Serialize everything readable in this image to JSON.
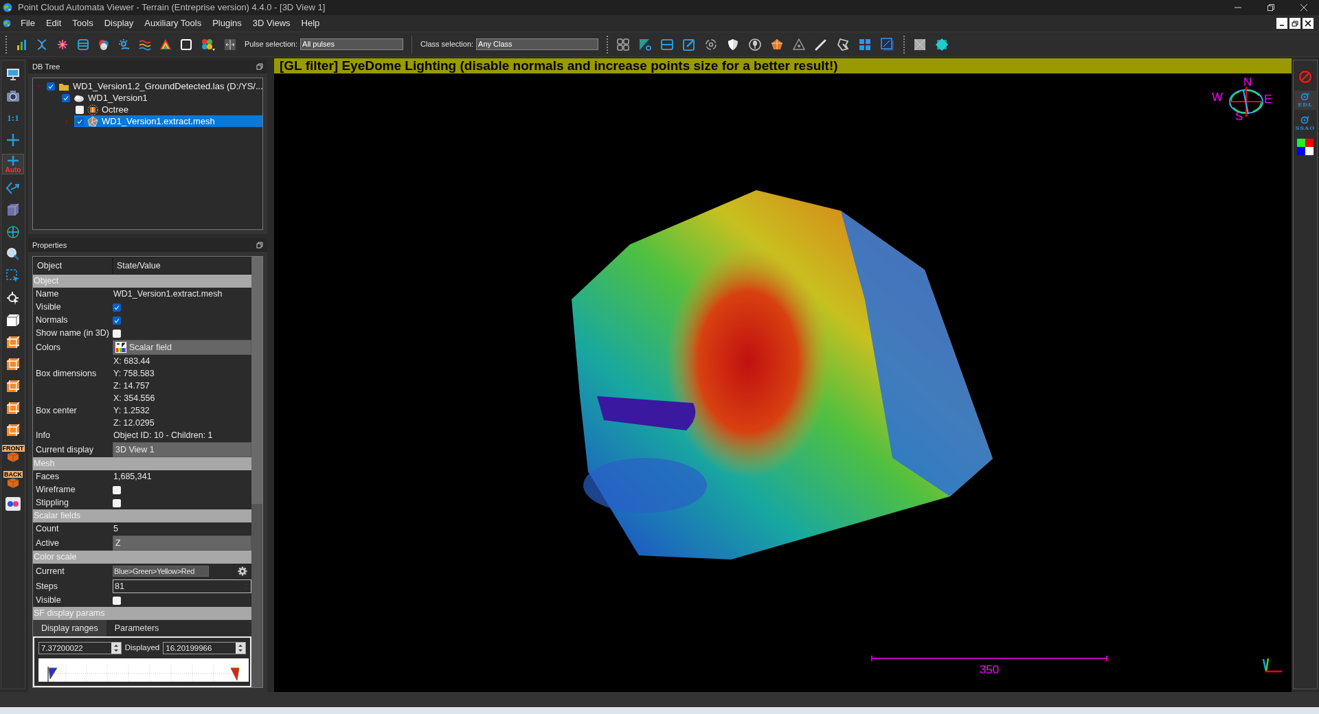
{
  "window": {
    "title": "Point Cloud Automata Viewer - Terrain (Entreprise version) 4.4.0 - [3D View 1]"
  },
  "menu": [
    "File",
    "Edit",
    "Tools",
    "Display",
    "Auxiliary Tools",
    "Plugins",
    "3D Views",
    "Help"
  ],
  "toolbar": {
    "pulse_selection": {
      "label": "Pulse selection:",
      "value": "All pulses"
    },
    "class_selection": {
      "label": "Class selection:",
      "value": "Any Class"
    }
  },
  "left_toolbar": [
    {
      "kind": "monitor",
      "selected": false
    },
    {
      "kind": "camera",
      "selected": false
    },
    {
      "kind": "ratio",
      "label": "1:1",
      "selected": false
    },
    {
      "kind": "cross",
      "selected": false
    },
    {
      "kind": "cross_auto",
      "label": "Auto",
      "selected": true
    },
    {
      "kind": "rotate",
      "selected": false
    },
    {
      "kind": "cube",
      "selected": false
    },
    {
      "kind": "move",
      "selected": false
    },
    {
      "kind": "zoom",
      "selected": false
    },
    {
      "kind": "select",
      "selected": false
    },
    {
      "kind": "pick",
      "selected": false
    },
    {
      "kind": "box",
      "selected": false
    },
    {
      "kind": "box_orange",
      "selected": false
    },
    {
      "kind": "box_orange",
      "selected": false
    },
    {
      "kind": "box_orange",
      "selected": false
    },
    {
      "kind": "box_orange",
      "selected": false
    },
    {
      "kind": "box_orange",
      "selected": false
    },
    {
      "kind": "labeled_cube",
      "label": "FRONT",
      "selected": false
    },
    {
      "kind": "labeled_cube",
      "label": "BACK",
      "selected": false
    },
    {
      "kind": "dots",
      "selected": false
    }
  ],
  "db_tree": {
    "title": "DB Tree",
    "items": [
      {
        "kind": "folder",
        "label": "WD1_Version1.2_GroundDetected.las (D:/YS/...",
        "checked": true,
        "selected": false,
        "expanded": true,
        "children": [
          {
            "kind": "cloud",
            "label": "WD1_Version1",
            "checked": true,
            "selected": false,
            "children": [
              {
                "kind": "octree",
                "label": "Octree",
                "checked": false,
                "selected": false
              },
              {
                "kind": "mesh",
                "label": "WD1_Version1.extract.mesh",
                "checked": true,
                "selected": true,
                "expanded": false
              }
            ]
          }
        ]
      }
    ]
  },
  "properties": {
    "title": "Properties",
    "columns": [
      "Object",
      "State/Value"
    ],
    "rows": [
      {
        "kind": "section",
        "label": "Object"
      },
      {
        "kind": "text",
        "label": "Name",
        "value": "WD1_Version1.extract.mesh"
      },
      {
        "kind": "checkbox",
        "label": "Visible",
        "checked": true
      },
      {
        "kind": "checkbox",
        "label": "Normals",
        "checked": true
      },
      {
        "kind": "checkbox",
        "label": "Show name (in 3D)",
        "checked": false
      },
      {
        "kind": "sf_combo",
        "label": "Colors",
        "value": "Scalar field"
      },
      {
        "kind": "lines",
        "label": "Box dimensions",
        "lines": [
          "X: 683.44",
          "Y: 758.583",
          "Z: 14.757"
        ]
      },
      {
        "kind": "lines",
        "label": "Box center",
        "lines": [
          "X: 354.556",
          "Y: 1.2532",
          "Z: 12.0295"
        ]
      },
      {
        "kind": "text",
        "label": "Info",
        "value": "Object ID: 10 - Children: 1"
      },
      {
        "kind": "combo",
        "label": "Current display",
        "value": "3D View 1"
      },
      {
        "kind": "section",
        "label": "Mesh"
      },
      {
        "kind": "text",
        "label": "Faces",
        "value": "1,685,341"
      },
      {
        "kind": "checkbox",
        "label": "Wireframe",
        "checked": false
      },
      {
        "kind": "checkbox",
        "label": "Stippling",
        "checked": false
      },
      {
        "kind": "section",
        "label": "Scalar fields"
      },
      {
        "kind": "text",
        "label": "Count",
        "value": "5"
      },
      {
        "kind": "combo",
        "label": "Active",
        "value": "Z"
      },
      {
        "kind": "section",
        "label": "Color scale"
      },
      {
        "kind": "scale",
        "label": "Current",
        "value": "Blue>Green>Yellow>Red"
      },
      {
        "kind": "spin",
        "label": "Steps",
        "value": "81"
      },
      {
        "kind": "checkbox",
        "label": "Visible",
        "checked": false
      },
      {
        "kind": "section",
        "label": "SF display params"
      }
    ],
    "sf_tabs": [
      {
        "label": "Display ranges",
        "selected": true
      },
      {
        "label": "Parameters",
        "selected": false
      }
    ],
    "range": {
      "min": "7.37200022",
      "label": "Displayed",
      "max": "16.20199966"
    }
  },
  "view": {
    "banner": "[GL filter] EyeDome Lighting (disable normals and increase points size for a better result!)",
    "compass": {
      "north": "N",
      "west": "W",
      "east": "E",
      "south": "S"
    },
    "scale_label": "350"
  },
  "right_toolbar": [
    {
      "kind": "stop",
      "selected": false
    },
    {
      "kind": "shader",
      "label": "EDL",
      "selected": true
    },
    {
      "kind": "shader",
      "label": "SSAO",
      "selected": false
    },
    {
      "kind": "colors",
      "selected": false
    }
  ]
}
